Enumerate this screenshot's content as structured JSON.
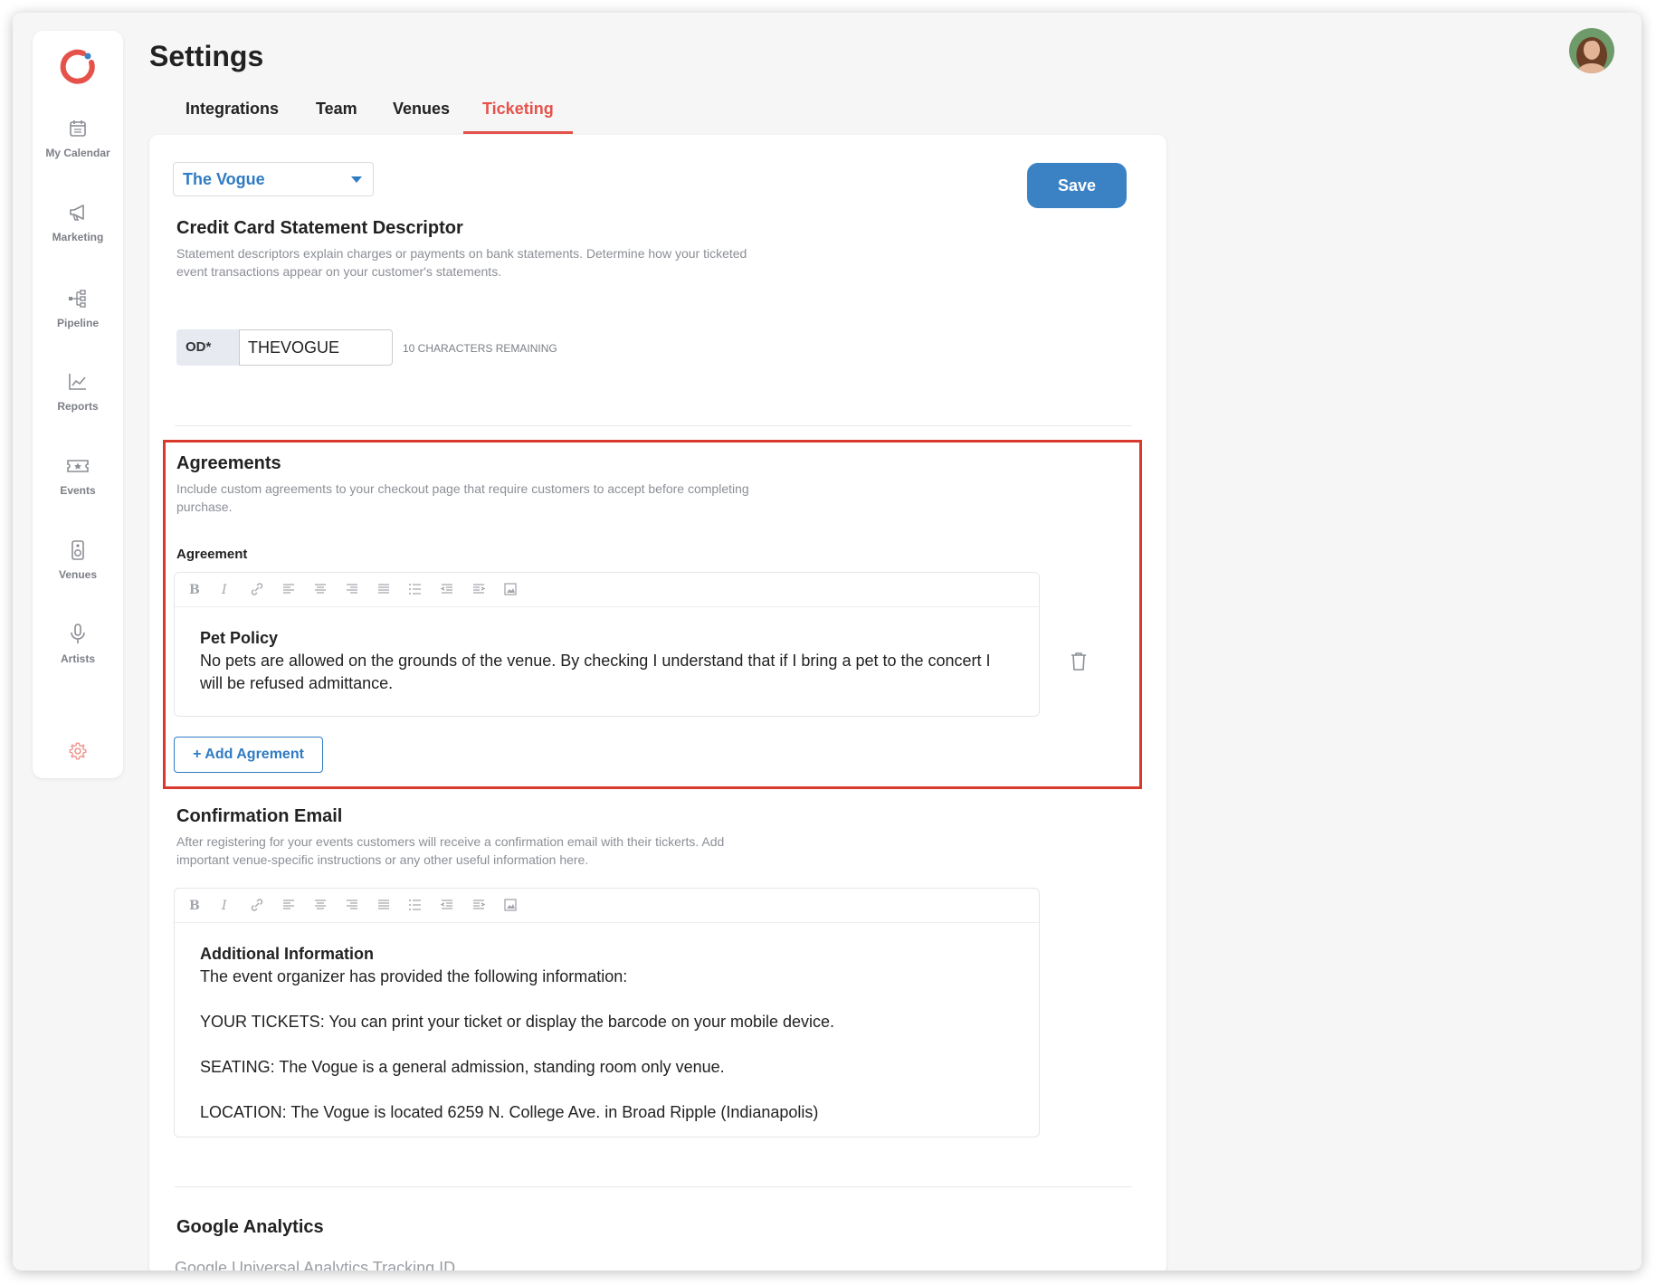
{
  "colors": {
    "accent": "#e5524a",
    "primary": "#3b82c4",
    "highlight_border": "#d93a2e"
  },
  "sidebar": {
    "logo": "app-logo",
    "items": [
      {
        "label": "My Calendar",
        "icon": "calendar-icon"
      },
      {
        "label": "Marketing",
        "icon": "megaphone-icon"
      },
      {
        "label": "Pipeline",
        "icon": "pipeline-icon"
      },
      {
        "label": "Reports",
        "icon": "chart-icon"
      },
      {
        "label": "Events",
        "icon": "ticket-icon"
      },
      {
        "label": "Venues",
        "icon": "speaker-icon"
      },
      {
        "label": "Artists",
        "icon": "microphone-icon"
      }
    ],
    "settings_icon": "gear-icon"
  },
  "header": {
    "title": "Settings",
    "tabs": [
      "Integrations",
      "Team",
      "Venues",
      "Ticketing"
    ],
    "active_tab": "Ticketing"
  },
  "venue_select": {
    "value": "The Vogue"
  },
  "save_label": "Save",
  "descriptor": {
    "title": "Credit Card Statement Descriptor",
    "description": "Statement descriptors explain charges or payments on bank statements. Determine how your ticketed event transactions appear on your customer's statements.",
    "prefix": "OD*",
    "value": "THEVOGUE",
    "remaining": "10 CHARACTERS REMAINING"
  },
  "agreements": {
    "title": "Agreements",
    "description": "Include custom agreements to your checkout page that require customers to accept before completing purchase.",
    "field_label": "Agreement",
    "agreement_title": "Pet Policy",
    "agreement_text": "No pets are allowed on the grounds of the venue. By checking I understand that if I bring a pet to the concert I will be refused admittance.",
    "add_label": "Add Agrement"
  },
  "confirmation": {
    "title": "Confirmation Email",
    "description": "After registering for your events customers will receive a confirmation email with their tickerts. Add important venue-specific instructions or any other useful information here.",
    "heading": "Additional Information",
    "line1": "The event organizer has provided the following information:",
    "line2": "YOUR TICKETS: You can print your ticket or display the barcode on your mobile device.",
    "line3": "SEATING: The Vogue is a general admission, standing room only venue.",
    "line4": "LOCATION: The Vogue is located 6259 N. College Ave. in Broad Ripple (Indianapolis)"
  },
  "analytics": {
    "title": "Google Analytics",
    "field_label": "Google Universal Analytics Tracking ID"
  }
}
